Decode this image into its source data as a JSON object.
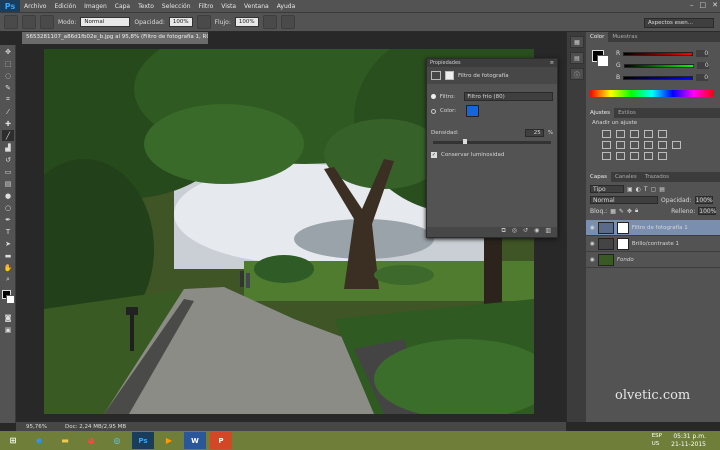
{
  "app": {
    "logo": "Ps"
  },
  "menu": [
    "Archivo",
    "Edición",
    "Imagen",
    "Capa",
    "Texto",
    "Selección",
    "Filtro",
    "Vista",
    "Ventana",
    "Ayuda"
  ],
  "options_bar": {
    "mode_label": "Modo:",
    "mode_value": "Normal",
    "opacity_label": "Opacidad:",
    "opacity_value": "100%",
    "flow_label": "Flujo:",
    "flow_value": "100%",
    "workspace": "Aspectos esen..."
  },
  "document": {
    "tab_title": "5653281107_a86d1fb02e_b.jpg al 95,8% (Filtro de fotografía 1, RGB/8) *",
    "zoom": "95,76%",
    "doc_info": "Doc: 2,24 MB/2,95 MB"
  },
  "properties": {
    "header": "Propiedades",
    "title": "Filtro de fotografía",
    "filter_label": "Filtro:",
    "filter_value": "Filtro frío (80)",
    "color_label": "Color:",
    "color_swatch": "#1565e0",
    "density_label": "Densidad:",
    "density_value": "25",
    "density_unit": "%",
    "preserve_label": "Conservar luminosidad",
    "preserve_checked": true
  },
  "color_panel": {
    "tabs": [
      "Color",
      "Muestras"
    ],
    "r": "0",
    "g": "0",
    "b": "0"
  },
  "adjust_panel": {
    "tabs": [
      "Ajustes",
      "Estilos"
    ],
    "title": "Añadir un ajuste"
  },
  "layers_panel": {
    "tabs": [
      "Capas",
      "Canales",
      "Trazados"
    ],
    "kind": "Tipo",
    "blend": "Normal",
    "opacity_label": "Opacidad:",
    "opacity_value": "100%",
    "lock_label": "Bloq.:",
    "fill_label": "Relleno:",
    "fill_value": "100%",
    "layers": [
      {
        "name": "Filtro de fotografía 1",
        "active": true
      },
      {
        "name": "Brillo/contraste 1",
        "active": false
      },
      {
        "name": "Fondo",
        "active": false
      }
    ]
  },
  "taskbar": {
    "lang_top": "ESP",
    "lang_bottom": "US",
    "time": "05:31 p.m.",
    "date": "21-11-2015"
  },
  "watermark": "olvetic.com"
}
